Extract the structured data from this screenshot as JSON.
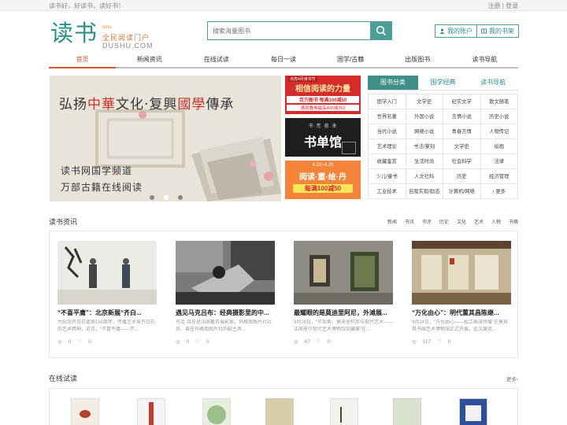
{
  "topbar": {
    "slogan": "读书好，好读书，读好书！",
    "auth": "注册 | 登录"
  },
  "logo": {
    "name": "读书",
    "beta": "beta",
    "slogan": "全民阅读门户",
    "domain": "DUSHU.COM"
  },
  "search": {
    "placeholder": "搜索海量图书"
  },
  "account": {
    "my_account": "我的账户",
    "my_shelf": "我的书架"
  },
  "nav": [
    "首页",
    "新闻资讯",
    "在线试读",
    "每日一读",
    "国学/古籍",
    "出版图书",
    "读书导航"
  ],
  "banner": {
    "heading_a": "弘扬",
    "heading_b": "中華",
    "heading_c": "文化·复興",
    "heading_d": "國學",
    "heading_e": "傳承",
    "line1": "读书网国学频道",
    "line2": "万部古籍在线阅读"
  },
  "ads": [
    {
      "top": "点亮4月读书节",
      "main": "相信阅读的力量",
      "sub": "百万图书 每满100减50",
      "sub2": "满就叠券最高400减250"
    },
    {
      "top": "书·荒·救·来",
      "main": "书单馆"
    },
    {
      "top": "4.22~4.25",
      "main": "阅读·重·绘·丹",
      "sub": "每满100减50"
    }
  ],
  "category": {
    "tabs": [
      "图书分类",
      "国学经典",
      "读书导航"
    ],
    "items": [
      "国学入门",
      "文学史",
      "纪实文学",
      "散文随笔",
      "世界名著",
      "外国小说",
      "言情小说",
      "历史小说",
      "当代小说",
      "网络小说",
      "青春言情",
      "人物传记",
      "艺术理论",
      "书法/篆刻",
      "文学史",
      "绘画",
      "收藏鉴赏",
      "生活时尚",
      "社会科学",
      "法律",
      "少儿/童书",
      "人文社科",
      "历史",
      "经济管理",
      "工业技术",
      "自我实现/励志",
      "计算机/网络",
      "更多"
    ]
  },
  "news_section": {
    "title": "读书资讯",
    "tags": [
      "新闻",
      "书讯",
      "书评",
      "历史",
      "文化",
      "艺术",
      "人物",
      "书摘"
    ]
  },
  "news": [
    {
      "title": "“不喜平庸”：北京新展“齐白...",
      "desc": "为纪念齐白石诞辰160周年，传播艺术家齐白石的艺术精神，近日，“不喜平庸——齐...",
      "views": "0",
      "likes": "0"
    },
    {
      "title": "遇见马克吕布：经典摄影里的中...",
      "desc": "马克·吕布是法国著名摄影家，玛格南图片社社员。曾任玛格南图片社的副主席...",
      "views": "0",
      "likes": "0"
    },
    {
      "title": "最耀眼的是莫迪里阿尼，外滩展...",
      "desc": "9月28日，“毕加索、莫迪里阿尼与现代艺术——法国里尔现代艺术博物馆馆藏展”在...",
      "views": "67",
      "likes": "0"
    },
    {
      "title": "“万化由心”：明代董其昌陈继...",
      "desc": "9月24日，“万化由心——松江画派特展”在莫其昌书画艺术博物馆正式开展。此次展览...",
      "views": "117",
      "likes": "0"
    }
  ],
  "trial_section": {
    "title": "在线试读",
    "more": "更多›"
  },
  "colors": {
    "accent": "#2c8f86",
    "active": "#d8543a"
  }
}
